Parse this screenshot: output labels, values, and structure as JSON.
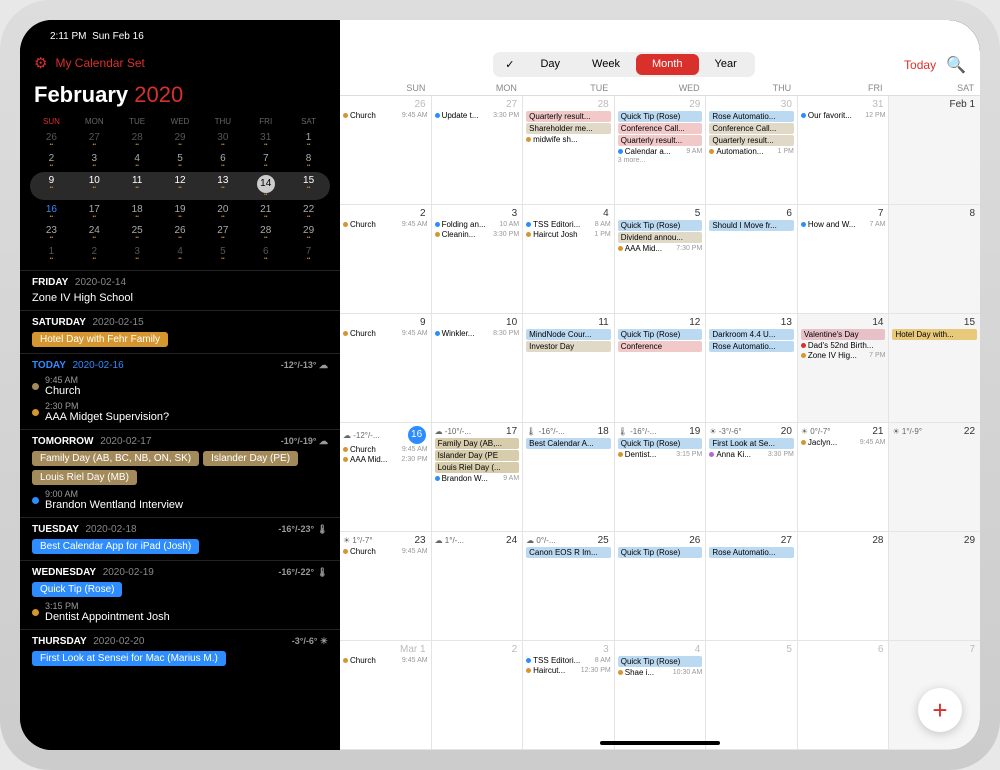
{
  "status": {
    "time": "2:11 PM",
    "date": "Sun Feb 16"
  },
  "sidebar": {
    "setName": "My Calendar Set",
    "monthName": "February",
    "year": "2020",
    "dow": [
      "SUN",
      "MON",
      "TUE",
      "WED",
      "THU",
      "FRI",
      "SAT"
    ],
    "mini": [
      [
        "26",
        "27",
        "28",
        "29",
        "30",
        "31",
        "1"
      ],
      [
        "2",
        "3",
        "4",
        "5",
        "6",
        "7",
        "8"
      ],
      [
        "9",
        "10",
        "11",
        "12",
        "13",
        "14",
        "15"
      ],
      [
        "16",
        "17",
        "18",
        "19",
        "20",
        "21",
        "22"
      ],
      [
        "23",
        "24",
        "25",
        "26",
        "27",
        "28",
        "29"
      ],
      [
        "1",
        "2",
        "3",
        "4",
        "5",
        "6",
        "7"
      ]
    ],
    "agenda": [
      {
        "label": "FRIDAY",
        "date": "2020-02-14",
        "temp": "",
        "events": [
          {
            "type": "txt",
            "text": "Zone IV High School"
          }
        ]
      },
      {
        "label": "SATURDAY",
        "date": "2020-02-15",
        "temp": "",
        "events": [
          {
            "type": "pill",
            "text": "Hotel Day with Fehr Family",
            "bg": "#d5952f"
          }
        ]
      },
      {
        "label": "TODAY",
        "date": "2020-02-16",
        "temp": "-12°/-13° ☁",
        "today": true,
        "events": [
          {
            "type": "dot",
            "time": "9:45 AM",
            "text": "Church",
            "c": "#a38a5b"
          },
          {
            "type": "dot",
            "time": "2:30 PM",
            "text": "AAA Midget Supervision?",
            "c": "#d5952f"
          }
        ]
      },
      {
        "label": "TOMORROW",
        "date": "2020-02-17",
        "temp": "-10°/-19° ☁",
        "events": [
          {
            "type": "pill",
            "text": "Family Day (AB, BC, NB, ON, SK)",
            "bg": "#a38a5b"
          },
          {
            "type": "pill",
            "text": "Islander Day (PE)",
            "bg": "#a38a5b"
          },
          {
            "type": "pill",
            "text": "Louis Riel Day (MB)",
            "bg": "#a38a5b"
          },
          {
            "type": "dot",
            "time": "9:00 AM",
            "text": "Brandon Wentland Interview",
            "c": "#2d8cff"
          }
        ]
      },
      {
        "label": "TUESDAY",
        "date": "2020-02-18",
        "temp": "-16°/-23° 🌡",
        "events": [
          {
            "type": "pill",
            "text": "Best Calendar App for iPad (Josh)",
            "bg": "#2d8cff"
          }
        ]
      },
      {
        "label": "WEDNESDAY",
        "date": "2020-02-19",
        "temp": "-16°/-22° 🌡",
        "events": [
          {
            "type": "pill",
            "text": "Quick Tip (Rose)",
            "bg": "#2d8cff"
          },
          {
            "type": "dot",
            "time": "3:15 PM",
            "text": "Dentist Appointment Josh",
            "c": "#d5952f"
          }
        ]
      },
      {
        "label": "THURSDAY",
        "date": "2020-02-20",
        "temp": "-3°/-6° ☀",
        "events": [
          {
            "type": "pill",
            "text": "First Look at Sensei for Mac (Marius M.)",
            "bg": "#2d8cff"
          }
        ]
      }
    ]
  },
  "toolbar": {
    "views": [
      "✓",
      "Day",
      "Week",
      "Month",
      "Year"
    ],
    "active": 3,
    "today": "Today"
  },
  "gridDow": [
    "SUN",
    "MON",
    "TUE",
    "WED",
    "THU",
    "FRI",
    "SAT"
  ],
  "weeks": [
    [
      {
        "n": "26",
        "dim": true,
        "events": [
          {
            "d": "#d5952f",
            "txt": "Church",
            "t": "9:45 AM"
          }
        ]
      },
      {
        "n": "27",
        "dim": true,
        "events": [
          {
            "d": "#2d8cff",
            "txt": "Update t...",
            "t": "3:30 PM"
          }
        ]
      },
      {
        "n": "28",
        "dim": true,
        "events": [
          {
            "b": "#f2c9c9",
            "txt": "Quarterly result..."
          },
          {
            "b": "#e0d9c7",
            "txt": "Shareholder me..."
          },
          {
            "d": "#d5952f",
            "txt": "midwife sh...",
            "t": ""
          }
        ]
      },
      {
        "n": "29",
        "dim": true,
        "events": [
          {
            "b": "#bcd9f2",
            "txt": "Quick Tip (Rose)"
          },
          {
            "b": "#f2c9c9",
            "txt": "Conference Call..."
          },
          {
            "b": "#f2c9c9",
            "txt": "Quarterly result..."
          },
          {
            "d": "#2d8cff",
            "txt": "Calendar a...",
            "t": "9 AM"
          }
        ],
        "more": "3 more..."
      },
      {
        "n": "30",
        "dim": true,
        "events": [
          {
            "b": "#bcd9f2",
            "txt": "Rose Automatio..."
          },
          {
            "b": "#e0d9c7",
            "txt": "Conference Call..."
          },
          {
            "b": "#e0d9c7",
            "txt": "Quarterly result..."
          },
          {
            "d": "#d5952f",
            "txt": "Automation...",
            "t": "1 PM"
          }
        ]
      },
      {
        "n": "31",
        "dim": true,
        "events": [
          {
            "d": "#2d8cff",
            "txt": "Our favorit...",
            "t": "12 PM"
          }
        ]
      },
      {
        "n": "Feb 1",
        "sat": true,
        "events": []
      }
    ],
    [
      {
        "n": "2",
        "events": [
          {
            "d": "#d5952f",
            "txt": "Church",
            "t": "9:45 AM"
          }
        ]
      },
      {
        "n": "3",
        "events": [
          {
            "d": "#2d8cff",
            "txt": "Folding an...",
            "t": "10 AM"
          },
          {
            "d": "#d5952f",
            "txt": "Cleanin...",
            "t": "3:30 PM"
          }
        ]
      },
      {
        "n": "4",
        "events": [
          {
            "d": "#2d8cff",
            "txt": "TSS Editori...",
            "t": "8 AM"
          },
          {
            "d": "#d5952f",
            "txt": "Haircut Josh",
            "t": "1 PM"
          }
        ]
      },
      {
        "n": "5",
        "events": [
          {
            "b": "#bcd9f2",
            "txt": "Quick Tip (Rose)"
          },
          {
            "b": "#e0d9c7",
            "txt": "Dividend annou..."
          },
          {
            "d": "#d5952f",
            "txt": "AAA Mid...",
            "t": "7:30 PM"
          }
        ]
      },
      {
        "n": "6",
        "events": [
          {
            "b": "#bcd9f2",
            "txt": "Should I Move fr..."
          }
        ]
      },
      {
        "n": "7",
        "events": [
          {
            "d": "#2d8cff",
            "txt": "How and W...",
            "t": "7 AM"
          }
        ]
      },
      {
        "n": "8",
        "sat": true,
        "events": []
      }
    ],
    [
      {
        "n": "9",
        "events": [
          {
            "d": "#d5952f",
            "txt": "Church",
            "t": "9:45 AM"
          }
        ]
      },
      {
        "n": "10",
        "events": [
          {
            "d": "#2d8cff",
            "txt": "Winkler...",
            "t": "8:30 PM"
          }
        ]
      },
      {
        "n": "11",
        "events": [
          {
            "b": "#bcd9f2",
            "txt": "MindNode Cour..."
          },
          {
            "b": "#e0d9c7",
            "txt": "Investor Day"
          }
        ]
      },
      {
        "n": "12",
        "events": [
          {
            "b": "#bcd9f2",
            "txt": "Quick Tip (Rose)"
          },
          {
            "b": "#f2c9c9",
            "txt": "Conference"
          }
        ]
      },
      {
        "n": "13",
        "events": [
          {
            "b": "#bcd9f2",
            "txt": "Darkroom 4.4 U..."
          },
          {
            "b": "#bcd9f2",
            "txt": "Rose Automatio..."
          }
        ]
      },
      {
        "n": "14",
        "sat": true,
        "events": [
          {
            "b": "#e8c0c8",
            "txt": "Valentine's Day"
          },
          {
            "d": "#d9302c",
            "txt": "Dad's 52nd Birth...",
            "b2": true
          },
          {
            "d": "#d5952f",
            "txt": "Zone IV Hig...",
            "t": "7 PM"
          }
        ]
      },
      {
        "n": "15",
        "sat": true,
        "events": [
          {
            "b": "#e8c87a",
            "txt": "Hotel Day with..."
          }
        ]
      }
    ],
    [
      {
        "n": "16",
        "today": true,
        "wx": "☁ -12°/-...",
        "events": [
          {
            "d": "#d5952f",
            "txt": "Church",
            "t": "9:45 AM"
          },
          {
            "d": "#d5952f",
            "txt": "AAA Mid...",
            "t": "2:30 PM"
          }
        ]
      },
      {
        "n": "17",
        "wx": "☁ -10°/-...",
        "events": [
          {
            "b": "#d7ccac",
            "txt": "Family Day (AB,..."
          },
          {
            "b": "#d7ccac",
            "txt": "Islander Day (PE"
          },
          {
            "b": "#d7ccac",
            "txt": "Louis Riel Day (..."
          },
          {
            "d": "#2d8cff",
            "txt": "Brandon W...",
            "t": "9 AM"
          }
        ]
      },
      {
        "n": "18",
        "wx": "🌡 -16°/-...",
        "events": [
          {
            "b": "#bcd9f2",
            "txt": "Best Calendar A..."
          }
        ]
      },
      {
        "n": "19",
        "wx": "🌡 -16°/-...",
        "events": [
          {
            "b": "#bcd9f2",
            "txt": "Quick Tip (Rose)"
          },
          {
            "d": "#d5952f",
            "txt": "Dentist...",
            "t": "3:15 PM"
          }
        ]
      },
      {
        "n": "20",
        "wx": "☀ -3°/-6°",
        "events": [
          {
            "b": "#bcd9f2",
            "txt": "First Look at Se..."
          },
          {
            "d": "#b565d6",
            "txt": "Anna Ki...",
            "t": "3:30 PM"
          }
        ]
      },
      {
        "n": "21",
        "wx": "☀ 0°/-7°",
        "events": [
          {
            "d": "#d5952f",
            "txt": "Jaclyn...",
            "t": "9:45 AM"
          }
        ]
      },
      {
        "n": "22",
        "sat": true,
        "wx": "☀ 1°/-9°",
        "events": []
      }
    ],
    [
      {
        "n": "23",
        "wx": "☀ 1°/-7°",
        "events": [
          {
            "d": "#d5952f",
            "txt": "Church",
            "t": "9:45 AM"
          }
        ]
      },
      {
        "n": "24",
        "wx": "☁ 1°/-...",
        "events": []
      },
      {
        "n": "25",
        "wx": "☁ 0°/-...",
        "events": [
          {
            "b": "#bcd9f2",
            "txt": "Canon EOS R Im..."
          }
        ]
      },
      {
        "n": "26",
        "events": [
          {
            "b": "#bcd9f2",
            "txt": "Quick Tip (Rose)"
          }
        ]
      },
      {
        "n": "27",
        "events": [
          {
            "b": "#bcd9f2",
            "txt": "Rose Automatio..."
          }
        ]
      },
      {
        "n": "28",
        "events": []
      },
      {
        "n": "29",
        "sat": true,
        "events": []
      }
    ],
    [
      {
        "n": "Mar 1",
        "dim": true,
        "events": [
          {
            "d": "#d5952f",
            "txt": "Church",
            "t": "9:45 AM"
          }
        ]
      },
      {
        "n": "2",
        "dim": true,
        "events": []
      },
      {
        "n": "3",
        "dim": true,
        "events": [
          {
            "d": "#2d8cff",
            "txt": "TSS Editori...",
            "t": "8 AM"
          },
          {
            "d": "#d5952f",
            "txt": "Haircut...",
            "t": "12:30 PM"
          }
        ]
      },
      {
        "n": "4",
        "dim": true,
        "events": [
          {
            "b": "#bcd9f2",
            "txt": "Quick Tip (Rose)"
          },
          {
            "d": "#d5952f",
            "txt": "Shae i...",
            "t": "10:30 AM"
          }
        ]
      },
      {
        "n": "5",
        "dim": true,
        "events": []
      },
      {
        "n": "6",
        "dim": true,
        "events": []
      },
      {
        "n": "7",
        "dim": true,
        "sat": true,
        "events": []
      }
    ]
  ]
}
